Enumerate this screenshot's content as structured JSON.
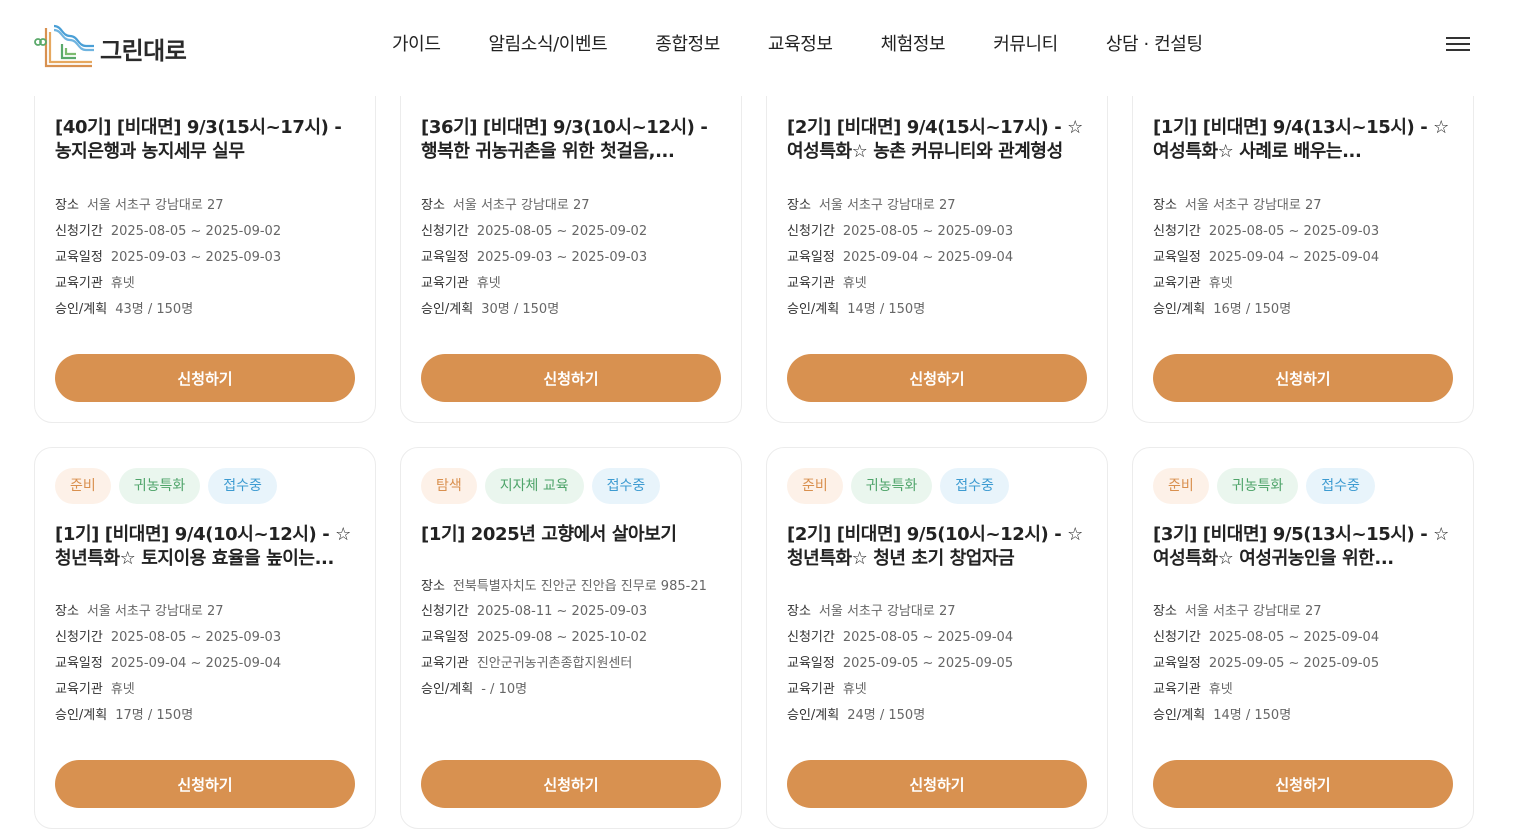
{
  "header": {
    "logo_text": "그린대로",
    "nav": [
      "가이드",
      "알림소식/이벤트",
      "종합정보",
      "교육정보",
      "체험정보",
      "커뮤니티",
      "상담 · 컨설팅"
    ],
    "menu_icon": "hamburger-menu-icon"
  },
  "labels": {
    "place": "장소",
    "apply_period": "신청기간",
    "edu_period": "교육일정",
    "institution": "교육기관",
    "approved": "승인/계획",
    "apply_button": "신청하기"
  },
  "colors": {
    "accent": "#d89150",
    "tag_orange": "#d9904f",
    "tag_green": "#4fa46a",
    "tag_blue": "#3d9bd1"
  },
  "cards": [
    {
      "title": "[40기] [비대면] 9/3(15시~17시) - 농지은행과 농지세무 실무",
      "place": "서울 서초구 강남대로 27",
      "apply_period": "2025-08-05 ~ 2025-09-02",
      "edu_period": "2025-09-03 ~ 2025-09-03",
      "institution": "휴넷",
      "approved": "43명 / 150명"
    },
    {
      "title": "[36기] [비대면] 9/3(10시~12시) - 행복한 귀농귀촌을 위한 첫걸음,...",
      "place": "서울 서초구 강남대로 27",
      "apply_period": "2025-08-05 ~ 2025-09-02",
      "edu_period": "2025-09-03 ~ 2025-09-03",
      "institution": "휴넷",
      "approved": "30명 / 150명"
    },
    {
      "title": "[2기] [비대면] 9/4(15시~17시) - ☆여성특화☆ 농촌 커뮤니티와 관계형성",
      "place": "서울 서초구 강남대로 27",
      "apply_period": "2025-08-05 ~ 2025-09-03",
      "edu_period": "2025-09-04 ~ 2025-09-04",
      "institution": "휴넷",
      "approved": "14명 / 150명"
    },
    {
      "title": "[1기] [비대면] 9/4(13시~15시) - ☆여성특화☆ 사례로 배우는...",
      "place": "서울 서초구 강남대로 27",
      "apply_period": "2025-08-05 ~ 2025-09-03",
      "edu_period": "2025-09-04 ~ 2025-09-04",
      "institution": "휴넷",
      "approved": "16명 / 150명"
    },
    {
      "tags": [
        "준비",
        "귀농특화",
        "접수중"
      ],
      "title": "[1기] [비대면] 9/4(10시~12시) - ☆청년특화☆ 토지이용 효율을 높이는...",
      "place": "서울 서초구 강남대로 27",
      "apply_period": "2025-08-05 ~ 2025-09-03",
      "edu_period": "2025-09-04 ~ 2025-09-04",
      "institution": "휴넷",
      "approved": "17명 / 150명"
    },
    {
      "tags": [
        "탐색",
        "지자체 교육",
        "접수중"
      ],
      "title": "[1기] 2025년 고향에서 살아보기",
      "place": "전북특별자치도 진안군 진안읍 진무로 985-21",
      "apply_period": "2025-08-11 ~ 2025-09-03",
      "edu_period": "2025-09-08 ~ 2025-10-02",
      "institution": "진안군귀농귀촌종합지원센터",
      "approved": "- / 10명"
    },
    {
      "tags": [
        "준비",
        "귀농특화",
        "접수중"
      ],
      "title": "[2기] [비대면] 9/5(10시~12시) - ☆청년특화☆ 청년 초기 창업자금",
      "place": "서울 서초구 강남대로 27",
      "apply_period": "2025-08-05 ~ 2025-09-04",
      "edu_period": "2025-09-05 ~ 2025-09-05",
      "institution": "휴넷",
      "approved": "24명 / 150명"
    },
    {
      "tags": [
        "준비",
        "귀농특화",
        "접수중"
      ],
      "title": "[3기] [비대면] 9/5(13시~15시) - ☆여성특화☆ 여성귀농인을 위한...",
      "place": "서울 서초구 강남대로 27",
      "apply_period": "2025-08-05 ~ 2025-09-04",
      "edu_period": "2025-09-05 ~ 2025-09-05",
      "institution": "휴넷",
      "approved": "14명 / 150명"
    }
  ]
}
